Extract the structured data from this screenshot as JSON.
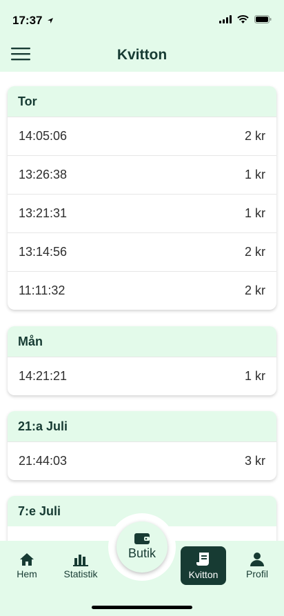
{
  "status_bar": {
    "time": "17:37"
  },
  "app_bar": {
    "title": "Kvitton"
  },
  "groups": [
    {
      "header": "Tor",
      "receipts": [
        {
          "time": "14:05:06",
          "amount": "2 kr"
        },
        {
          "time": "13:26:38",
          "amount": "1 kr"
        },
        {
          "time": "13:21:31",
          "amount": "1 kr"
        },
        {
          "time": "13:14:56",
          "amount": "2 kr"
        },
        {
          "time": "11:11:32",
          "amount": "2 kr"
        }
      ]
    },
    {
      "header": "Mån",
      "receipts": [
        {
          "time": "14:21:21",
          "amount": "1 kr"
        }
      ]
    },
    {
      "header": "21:a Juli",
      "receipts": [
        {
          "time": "21:44:03",
          "amount": "3 kr"
        }
      ]
    },
    {
      "header": "7:e Juli",
      "receipts": []
    }
  ],
  "bottom_nav": {
    "items": [
      {
        "label": "Hem",
        "icon": "home-icon"
      },
      {
        "label": "Statistik",
        "icon": "bar-chart-icon"
      },
      {
        "label": "Kvitton",
        "icon": "receipt-icon",
        "active": true
      },
      {
        "label": "Profil",
        "icon": "person-icon"
      }
    ],
    "center": {
      "label": "Butik",
      "icon": "wallet-icon"
    }
  },
  "colors": {
    "accent": "#173b33",
    "header_bg": "#e3faea"
  }
}
